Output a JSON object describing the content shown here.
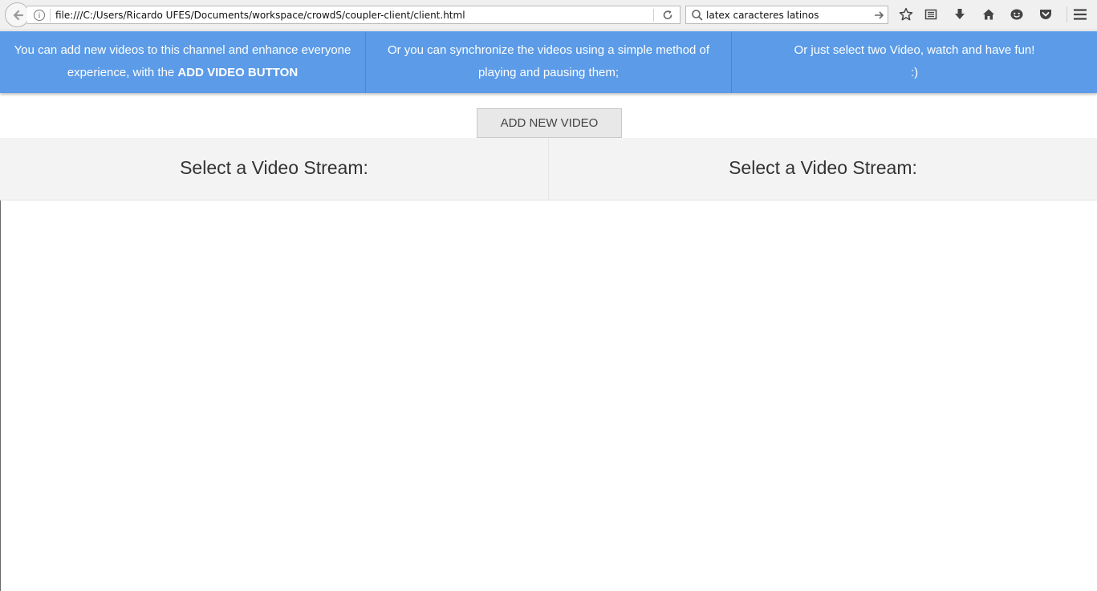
{
  "browser": {
    "url": "file:///C:/Users/Ricardo UFES/Documents/workspace/crowdS/coupler-client/client.html",
    "search_query": "latex caracteres latinos",
    "icons": [
      "back-icon",
      "info-icon",
      "reload-icon",
      "search-icon",
      "arrow-right-icon",
      "star-icon",
      "reading-list-icon",
      "download-icon",
      "home-icon",
      "hello-icon",
      "pocket-icon",
      "menu-icon"
    ]
  },
  "banner": {
    "tip1_text": "You can add new videos to this channel and enhance everyone experience, with the ",
    "tip1_bold": "ADD VIDEO BUTTON",
    "tip2_text": "Or you can synchronize the videos using a simple method of playing and pausing them;",
    "tip3_line1": "Or just select two Video, watch and have fun!",
    "tip3_line2": ":)",
    "background_color": "#5b9be8"
  },
  "add_video_button": {
    "label": "ADD NEW VIDEO"
  },
  "streams": [
    {
      "label": "Select a Video Stream:"
    },
    {
      "label": "Select a Video Stream:"
    }
  ]
}
